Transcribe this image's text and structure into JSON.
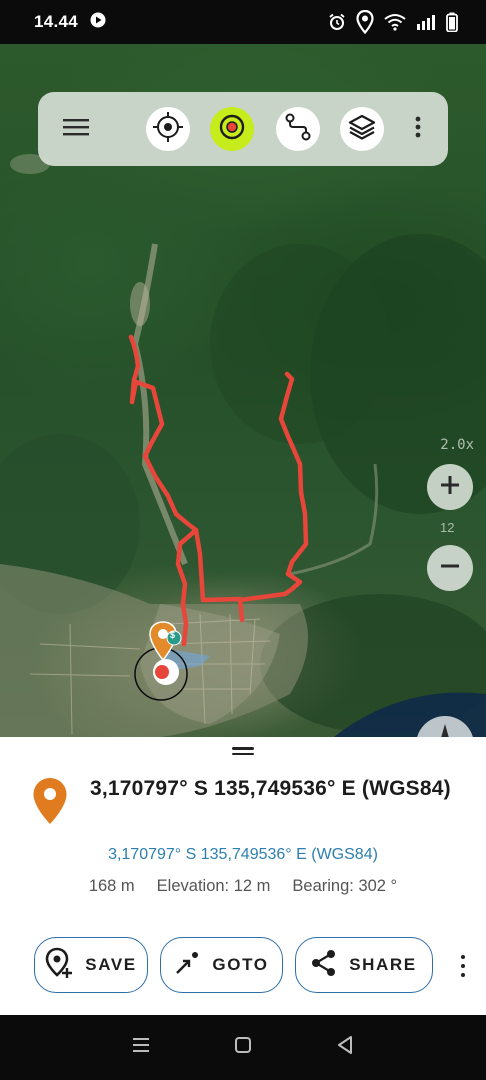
{
  "status_bar": {
    "time": "14.44",
    "icons": [
      "media-icon",
      "alarm-icon",
      "location-icon",
      "wifi-icon",
      "signal-icon",
      "battery-icon"
    ]
  },
  "toolbar": {
    "buttons": [
      "menu-icon",
      "locate-crosshair-icon",
      "track-record-icon",
      "route-icon",
      "layers-icon",
      "more-vert-icon"
    ],
    "accent_color": "#c6ec1c"
  },
  "map": {
    "zoom_scale": "2.0x",
    "zoom_level": "12",
    "track_color": "#e8463a",
    "marker_badge": "$"
  },
  "sheet": {
    "coordinates_title": "3,170797° S 135,749536° E (WGS84)",
    "coordinates_link": "3,170797° S 135,749536° E (WGS84)",
    "distance": "168 m",
    "elevation": "Elevation: 12 m",
    "bearing": "Bearing: 302 °",
    "pin_color": "#e07b1f",
    "accent_color": "#2f6fa8"
  },
  "actions": {
    "save": "SAVE",
    "goto": "GOTO",
    "share": "SHARE"
  },
  "nav_bar": {
    "buttons": [
      "recents-icon",
      "home-icon",
      "back-icon"
    ]
  }
}
